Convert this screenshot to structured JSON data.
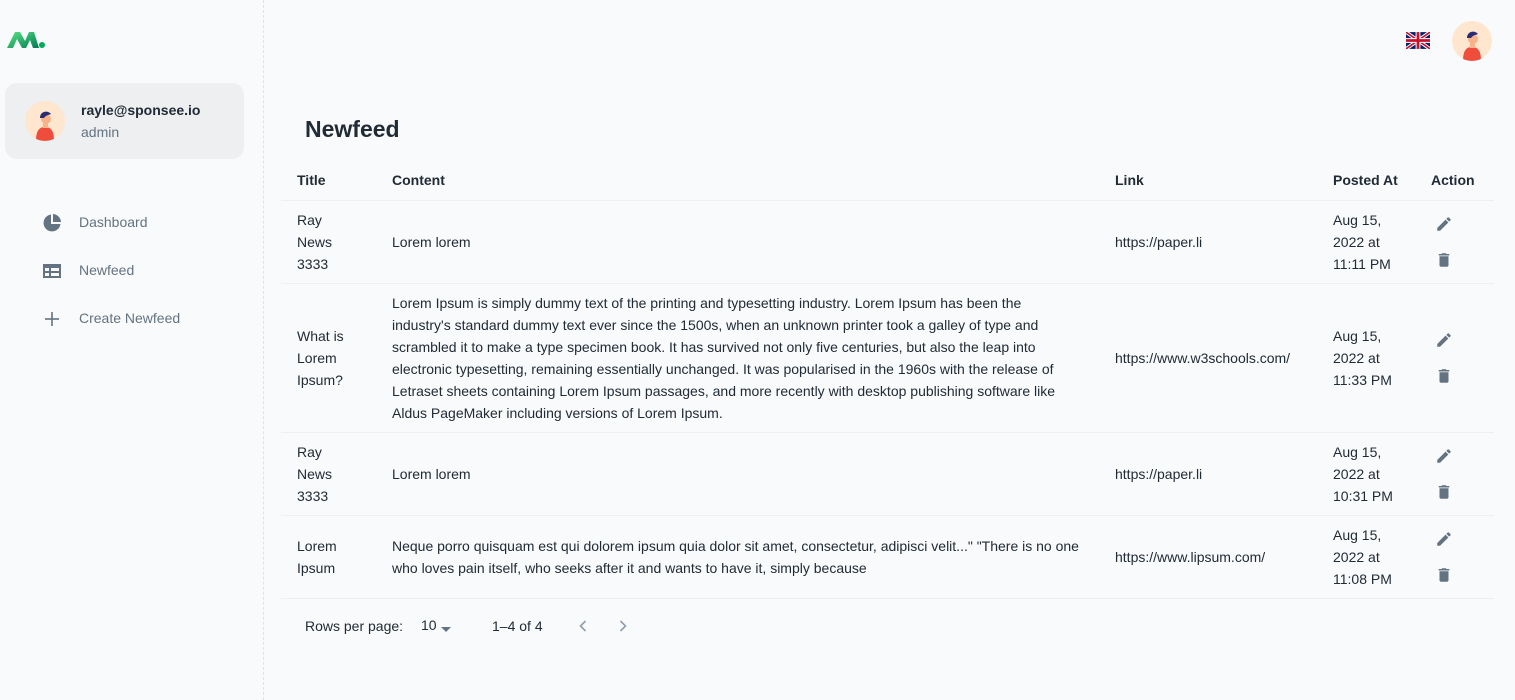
{
  "account": {
    "email": "rayle@sponsee.io",
    "role": "admin"
  },
  "nav": [
    {
      "label": "Dashboard",
      "icon": "pie-chart-icon"
    },
    {
      "label": "Newfeed",
      "icon": "table-icon"
    },
    {
      "label": "Create Newfeed",
      "icon": "plus-icon"
    }
  ],
  "header": {
    "language_icon": "uk-flag-icon"
  },
  "page": {
    "title": "Newfeed"
  },
  "table": {
    "headers": {
      "title": "Title",
      "content": "Content",
      "link": "Link",
      "posted_at": "Posted At",
      "action": "Action"
    },
    "rows": [
      {
        "title": "Ray News 3333",
        "content": "Lorem lorem",
        "link": "https://paper.li",
        "posted_at": "Aug 15, 2022 at 11:11 PM"
      },
      {
        "title": "What is Lorem Ipsum?",
        "content": "Lorem Ipsum is simply dummy text of the printing and typesetting industry. Lorem Ipsum has been the industry's standard dummy text ever since the 1500s, when an unknown printer took a galley of type and scrambled it to make a type specimen book. It has survived not only five centuries, but also the leap into electronic typesetting, remaining essentially unchanged. It was popularised in the 1960s with the release of Letraset sheets containing Lorem Ipsum passages, and more recently with desktop publishing software like Aldus PageMaker including versions of Lorem Ipsum.",
        "link": "https://www.w3schools.com/",
        "posted_at": "Aug 15, 2022 at 11:33 PM"
      },
      {
        "title": "Ray News 3333",
        "content": "Lorem lorem",
        "link": "https://paper.li",
        "posted_at": "Aug 15, 2022 at 10:31 PM"
      },
      {
        "title": "Lorem Ipsum",
        "content": "Neque porro quisquam est qui dolorem ipsum quia dolor sit amet, consectetur, adipisci velit...\" \"There is no one who loves pain itself, who seeks after it and wants to have it, simply because",
        "link": "https://www.lipsum.com/",
        "posted_at": "Aug 15, 2022 at 11:08 PM"
      }
    ]
  },
  "pagination": {
    "rows_per_page_label": "Rows per page:",
    "rows_per_page": "10",
    "range": "1–4 of 4"
  },
  "colors": {
    "accent": "#00ab55",
    "text": "#212b36",
    "muted": "#637381",
    "background": "#f9fafb"
  }
}
